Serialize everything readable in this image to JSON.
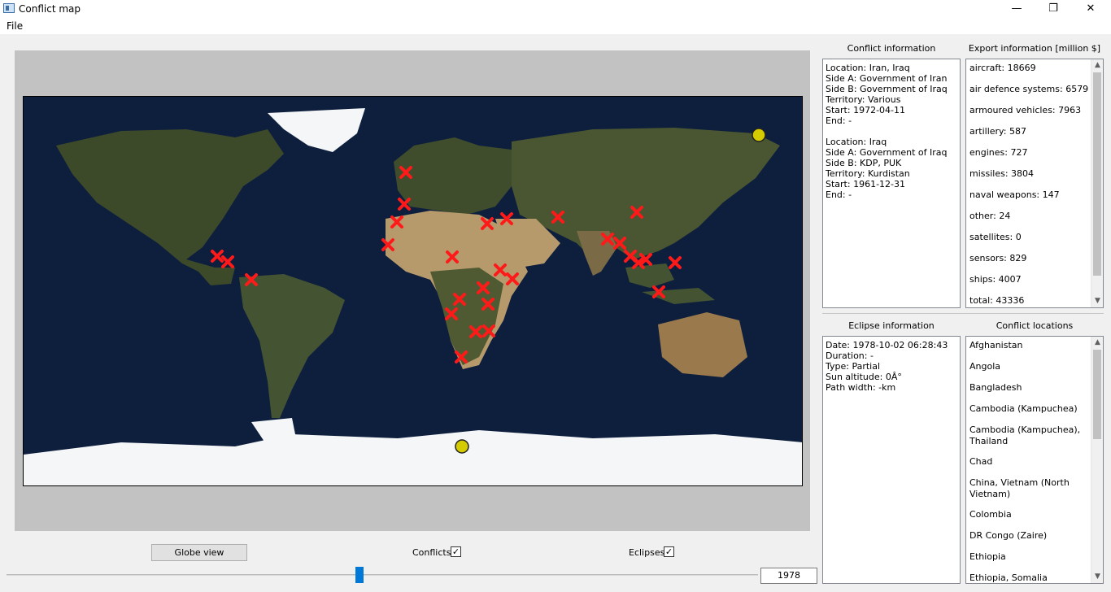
{
  "window": {
    "title": "Conflict map",
    "minimize": "—",
    "maximize": "❐",
    "close": "✕"
  },
  "menu": {
    "file": "File"
  },
  "conflict_panel": {
    "title": "Conflict information",
    "text": "Location: Iran, Iraq\nSide A: Government of Iran\nSide B: Government of Iraq\nTerritory: Various\nStart: 1972-04-11\nEnd: -\n\nLocation: Iraq\nSide A: Government of Iraq\nSide B: KDP, PUK\nTerritory: Kurdistan\nStart: 1961-12-31\nEnd: -"
  },
  "export_panel": {
    "title": "Export information [million $]",
    "items": [
      "aircraft: 18669",
      "air defence systems: 6579",
      "armoured vehicles: 7963",
      "artillery: 587",
      "engines: 727",
      "missiles: 3804",
      "naval weapons: 147",
      "other: 24",
      "satellites: 0",
      "sensors: 829",
      "ships: 4007",
      "total: 43336"
    ]
  },
  "eclipse_panel": {
    "title": "Eclipse information",
    "text": "Date: 1978-10-02 06:28:43\nDuration: -\nType: Partial\nSun altitude: 0Â°\nPath width: -km"
  },
  "locations_panel": {
    "title": "Conflict locations",
    "items": [
      "Afghanistan",
      "Angola",
      "Bangladesh",
      "Cambodia (Kampuchea)",
      "Cambodia (Kampuchea), Thailand",
      "Chad",
      "China, Vietnam (North Vietnam)",
      "Colombia",
      "DR Congo (Zaire)",
      "Ethiopia",
      "Ethiopia, Somalia"
    ]
  },
  "controls": {
    "globe_button": "Globe view",
    "conflicts_label": "Conflicts",
    "conflicts_checked": true,
    "eclipses_label": "Eclipses",
    "eclipses_checked": true,
    "year": "1978",
    "check_glyph": "✓"
  },
  "colors": {
    "conflict_marker": "#ff1a1a",
    "eclipse_marker": "#d4cc00",
    "ocean": "#0e1f3e",
    "land": "#3d4a2a",
    "ice": "#f4f6f8",
    "desert": "#b79a6c"
  }
}
